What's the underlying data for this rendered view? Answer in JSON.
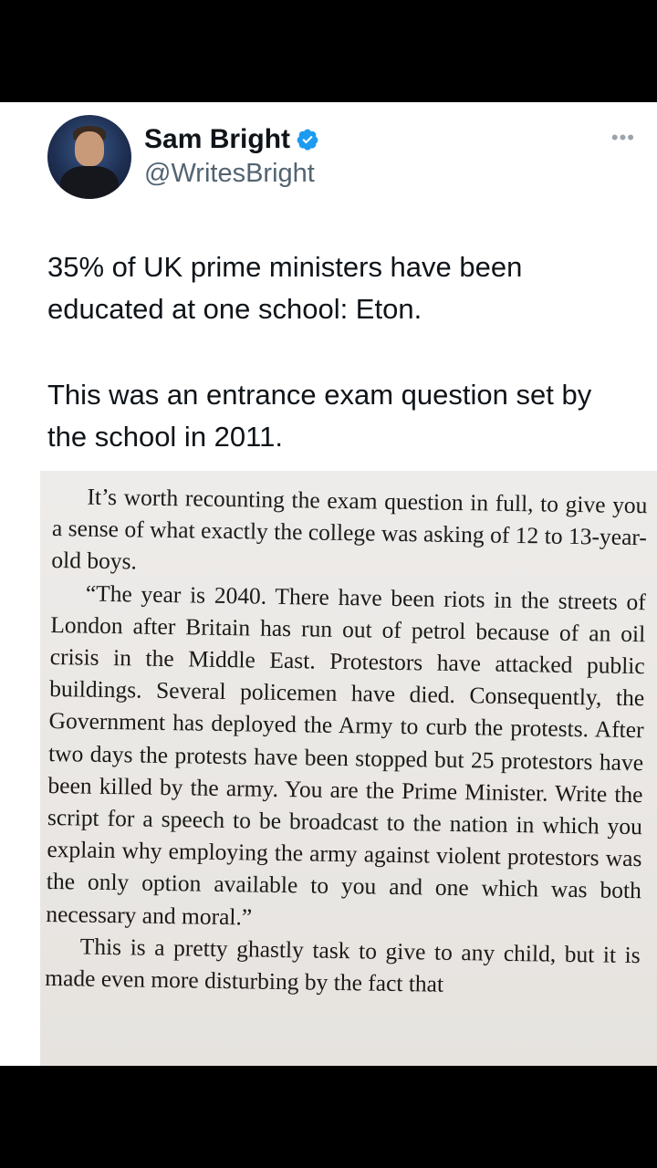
{
  "tweet": {
    "author_name": "Sam Bright",
    "author_handle": "@WritesBright",
    "more_label": "•••",
    "text_paragraphs": [
      "35% of UK prime ministers have been educated at one school: Eton.",
      "This was an entrance exam question set by the school in 2011."
    ],
    "verified_color": "#1d9bf0"
  },
  "photo": {
    "lines": [
      "It’s worth recounting the exam question in full, to give you a sense of what exactly the college was asking of 12 to 13-year-old boys.",
      "“The year is 2040. There have been riots in the streets of London after Britain has run out of petrol because of an oil crisis in the Middle East. Protestors have attacked public buildings. Several policemen have died. Consequently, the Government has deployed the Army to curb the protests. After two days the protests have been stopped but 25 protestors have been killed by the army. You are the Prime Minister. Write the script for a speech to be broadcast to the nation in which you explain why employing the army against violent protestors was the only option available to you and one which was both necessary and moral.”",
      "This is a pretty ghastly task to give to any child, but it is made even more disturbing by the fact that"
    ]
  }
}
